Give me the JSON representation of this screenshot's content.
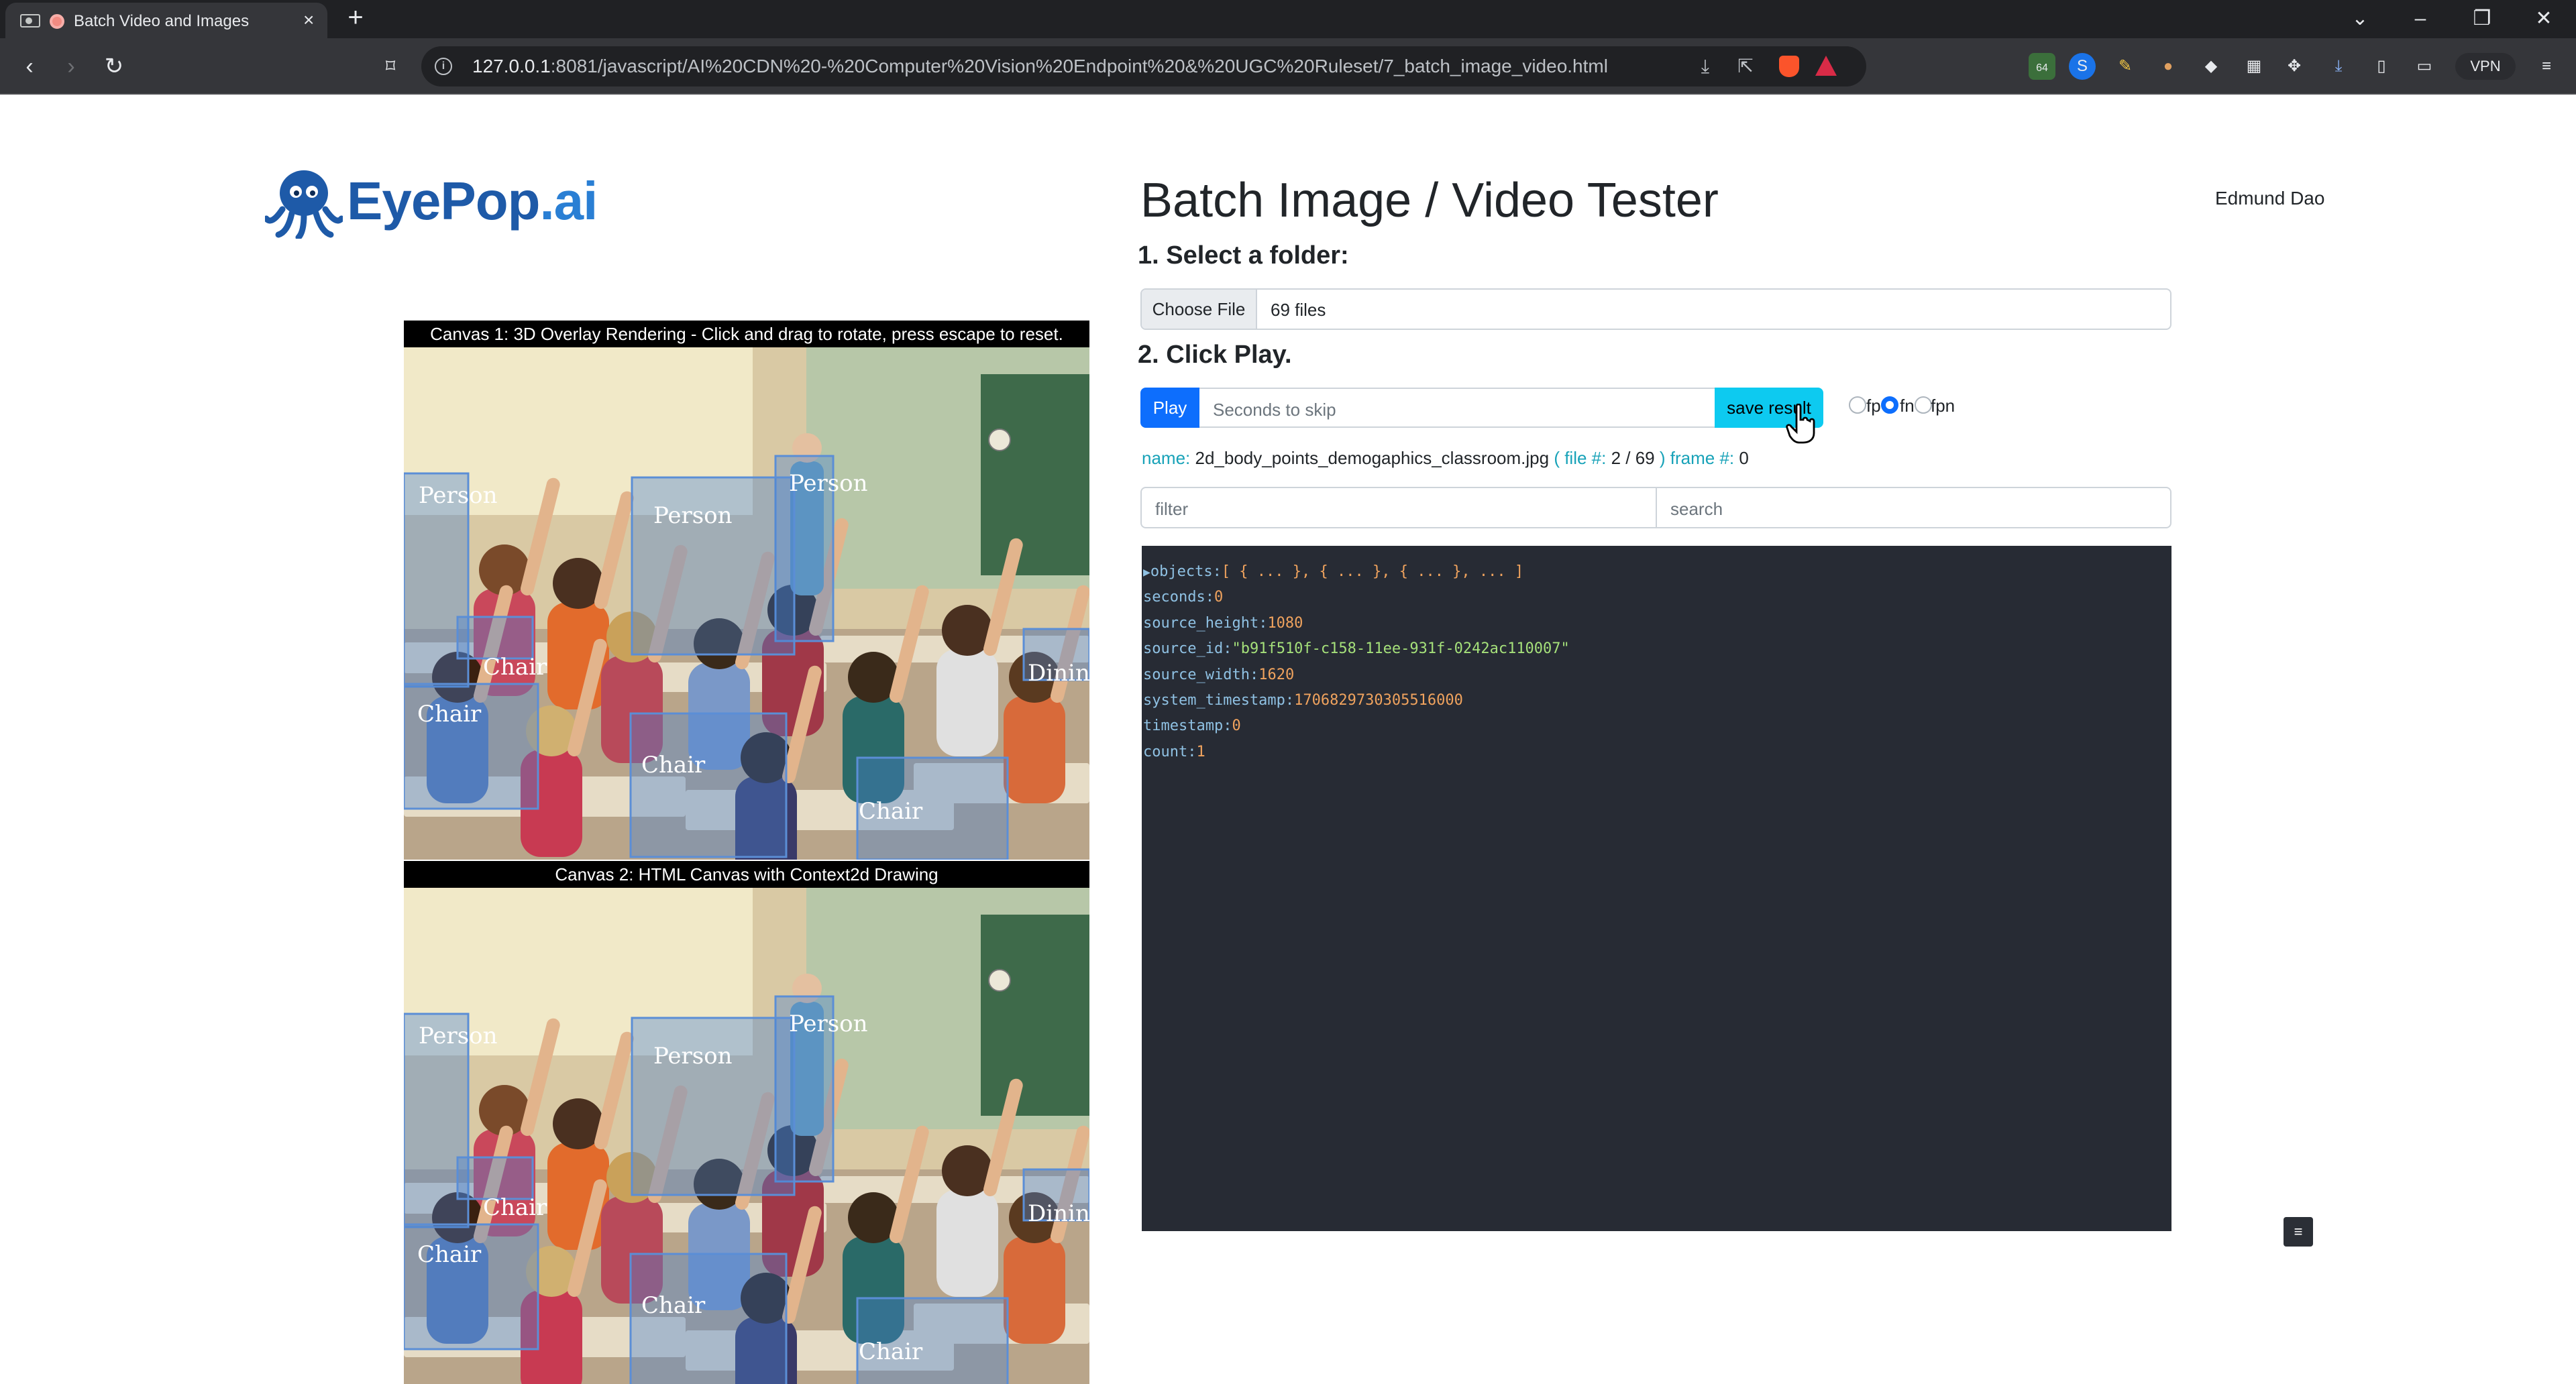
{
  "browser": {
    "tab_title": "Batch Video and Images",
    "url_host": "127.0.0.1",
    "url_rest": ":8081/javascript/AI%20CDN%20-%20Computer%20Vision%20Endpoint%20&%20UGC%20Ruleset/7_batch_image_video.html",
    "extensions_badge": "64",
    "vpn_label": "VPN"
  },
  "header": {
    "logo_part1": "EyePop",
    "logo_part2": ".ai",
    "title": "Batch Image / Video Tester",
    "user_name": "Edmund Dao"
  },
  "steps": {
    "step1": "1. Select a folder:",
    "step2": "2. Click Play."
  },
  "file_input": {
    "button_label": "Choose File",
    "status": "69 files"
  },
  "controls": {
    "play_label": "Play",
    "skip_placeholder": "Seconds to skip",
    "save_label": "save result",
    "radio_options": [
      "fp",
      "fn",
      "fpn"
    ],
    "radio_selected": "fn"
  },
  "file_meta": {
    "name_label": "name:",
    "name_value": "2d_body_points_demogaphics_classroom.jpg",
    "file_label": "( file #:",
    "file_value": "2 / 69",
    "frame_label": ") frame #:",
    "frame_value": "0"
  },
  "filters": {
    "filter_placeholder": "filter",
    "search_placeholder": "search"
  },
  "json_view": {
    "lines": [
      {
        "key": "objects",
        "value": "[ { ... }, { ... }, { ... }, ... ]",
        "type": "obj",
        "arrow": "▶"
      },
      {
        "key": "seconds",
        "value": "0",
        "type": "num"
      },
      {
        "key": "source_height",
        "value": "1080",
        "type": "num"
      },
      {
        "key": "source_id",
        "value": "\"b91f510f-c158-11ee-931f-0242ac110007\"",
        "type": "str"
      },
      {
        "key": "source_width",
        "value": "1620",
        "type": "num"
      },
      {
        "key": "system_timestamp",
        "value": "1706829730305516000",
        "type": "num"
      },
      {
        "key": "timestamp",
        "value": "0",
        "type": "num"
      },
      {
        "key": "count",
        "value": "1",
        "type": "num"
      }
    ]
  },
  "canvas1": {
    "caption": "Canvas 1: 3D Overlay Rendering - Click and drag to rotate, press escape to reset."
  },
  "canvas2": {
    "caption": "Canvas 2: HTML Canvas with Context2d Drawing"
  },
  "detections": [
    {
      "label": "Person"
    },
    {
      "label": "Person"
    },
    {
      "label": "Person"
    },
    {
      "label": "Chair"
    },
    {
      "label": "Chair"
    },
    {
      "label": "Dining Table"
    },
    {
      "label": "Chair"
    },
    {
      "label": "Chair"
    }
  ],
  "colors": {
    "primary": "#0d6efd",
    "info": "#0dcaf0",
    "meta_key": "#17a2b8",
    "json_bg": "#272b34",
    "box": "#5b8ed6"
  },
  "icons": {
    "back": "arrow-left-icon",
    "forward": "arrow-right-icon",
    "reload": "reload-icon",
    "bookmark": "bookmark-icon",
    "download": "download-icon",
    "share": "share-icon",
    "menu": "hamburger-icon"
  }
}
